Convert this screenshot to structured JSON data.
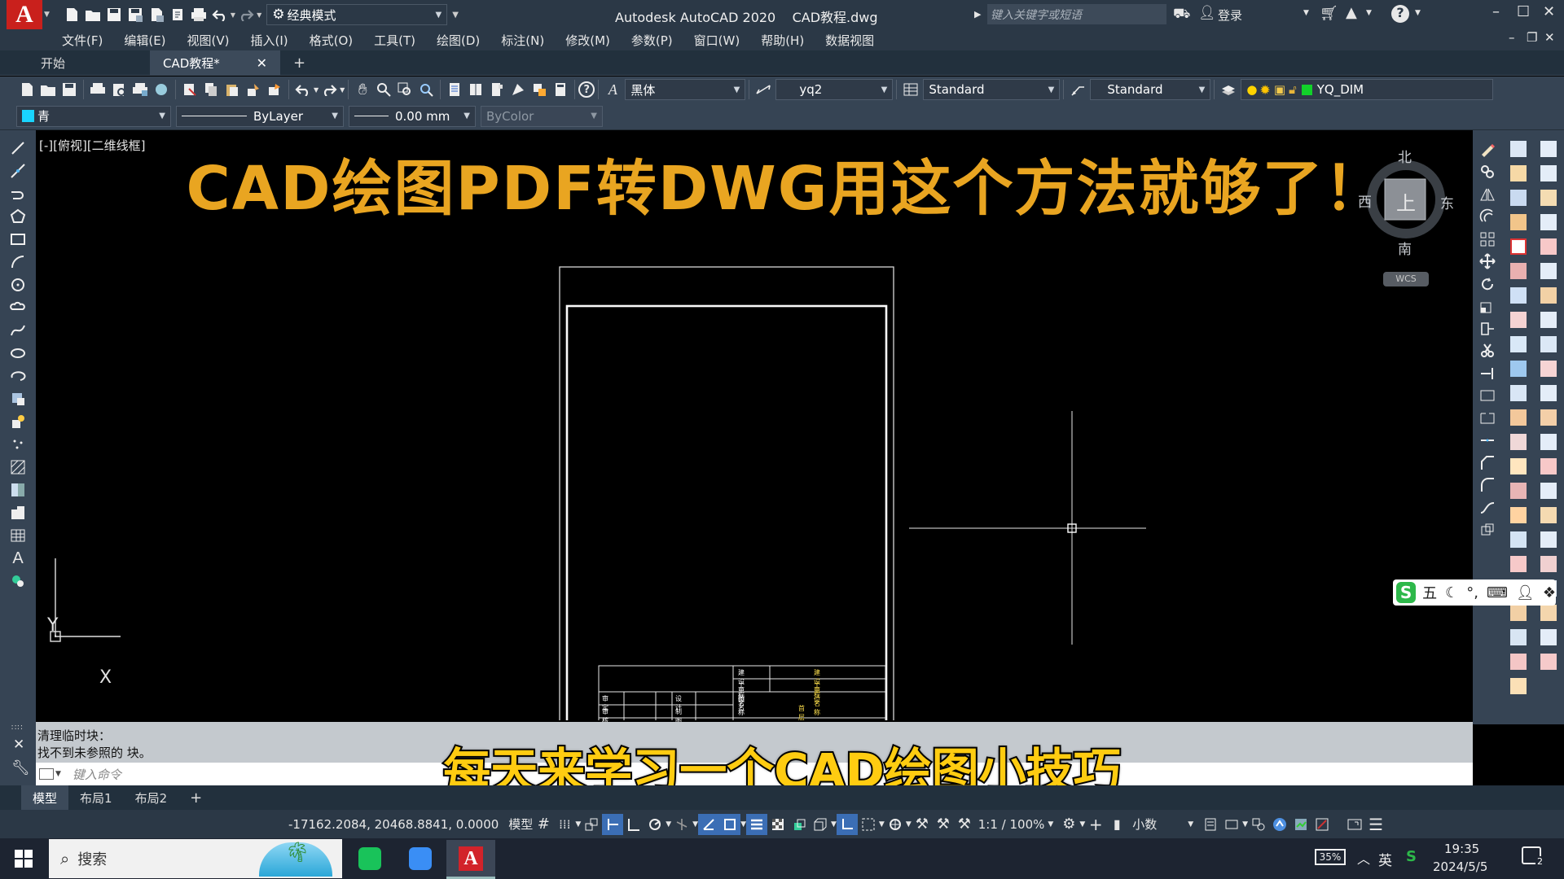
{
  "app": {
    "title": "Autodesk AutoCAD 2020    CAD教程.dwg",
    "workspace": "经典模式",
    "search_placeholder": "键入关键字或短语",
    "login": "登录",
    "brand_color": "#c9201c"
  },
  "menu": [
    "文件(F)",
    "编辑(E)",
    "视图(V)",
    "插入(I)",
    "格式(O)",
    "工具(T)",
    "绘图(D)",
    "标注(N)",
    "修改(M)",
    "参数(P)",
    "窗口(W)",
    "帮助(H)",
    "数据视图"
  ],
  "doc_tabs": {
    "start": "开始",
    "current": "CAD教程*",
    "add": "+"
  },
  "toolbar1": {
    "text_style": "黑体",
    "dim_style": "yq2",
    "table_style": "Standard",
    "multileader_style": "Standard",
    "layer": "YQ_DIM"
  },
  "toolbar2": {
    "color": "青",
    "linetype": "ByLayer",
    "lineweight": "0.00 mm",
    "plotstyle": "ByColor"
  },
  "canvas": {
    "view_label": "[-][俯视][二维线框]",
    "overlay_title": "CAD绘图PDF转DWG用这个方法就够了！",
    "subtitle": "每天来学习一个CAD绘图小技巧",
    "viewcube": {
      "north": "北",
      "south": "南",
      "east": "东",
      "west": "西",
      "top": "上",
      "wcs": "WCS"
    },
    "ucs": {
      "x": "X",
      "y": "Y"
    },
    "titleblock": {
      "r1": [
        "建设单位",
        "建设单位"
      ],
      "r2": [
        "工程名称",
        "工程名称"
      ],
      "r3": [
        "审 定",
        "设 计",
        "图名"
      ],
      "r4": [
        "审 核",
        "制 图",
        "首层平面图"
      ]
    }
  },
  "ime": {
    "mode": "五"
  },
  "command": {
    "history": [
      "清理临时块：",
      "找不到未参照的 块。"
    ],
    "placeholder": "键入命令"
  },
  "layout_tabs": [
    "模型",
    "布局1",
    "布局2"
  ],
  "status": {
    "coords": "-17162.2084, 20468.8841, 0.0000",
    "model": "模型",
    "scale": "1:1 / 100%",
    "units": "小数"
  },
  "taskbar": {
    "search": "搜索",
    "battery": "35%",
    "lang": "英",
    "time": "19:35",
    "date": "2024/5/5",
    "notifications": "2"
  }
}
